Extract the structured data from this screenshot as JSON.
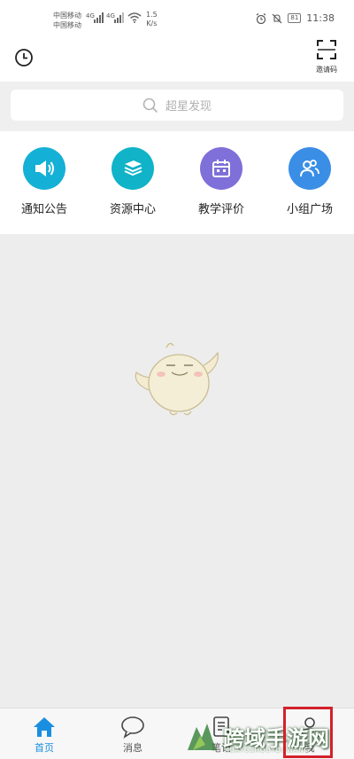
{
  "status_bar": {
    "carrier_1": "中国移动",
    "carrier_2": "中国移动",
    "signal_1": "4G",
    "signal_2": "4G",
    "speed_value": "1.5",
    "speed_unit": "K/s",
    "battery": "81",
    "time": "11:38"
  },
  "header": {
    "invite_label": "邀请码"
  },
  "search": {
    "placeholder": "超星发现"
  },
  "features": [
    {
      "label": "通知公告",
      "color": "#15b0d6",
      "icon": "megaphone-icon"
    },
    {
      "label": "资源中心",
      "color": "#10b3c8",
      "icon": "books-icon"
    },
    {
      "label": "教学评价",
      "color": "#7f6fd8",
      "icon": "calendar-icon"
    },
    {
      "label": "小组广场",
      "color": "#3a8ee6",
      "icon": "group-icon"
    }
  ],
  "tabs": [
    {
      "label": "首页",
      "icon": "home-icon",
      "active": true
    },
    {
      "label": "消息",
      "icon": "chat-bubble-icon",
      "active": false
    },
    {
      "label": "笔记",
      "icon": "note-icon",
      "active": false
    },
    {
      "label": "我",
      "icon": "profile-icon",
      "active": false
    }
  ],
  "watermark": {
    "title": "跨域手游网",
    "subtitle": "KUAYUSHOUYOUWANG"
  },
  "colors": {
    "accent": "#1a8fe0",
    "highlight": "#d3212b"
  }
}
